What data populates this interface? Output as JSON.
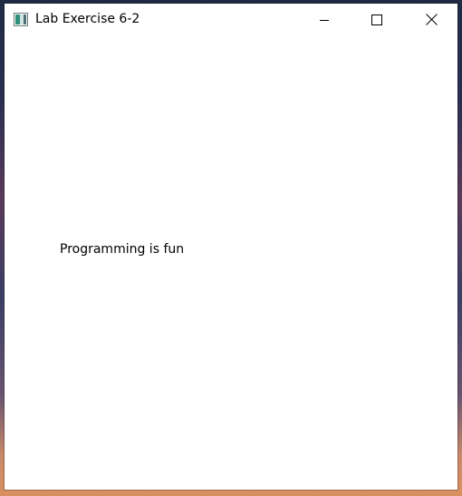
{
  "window": {
    "title": "Lab Exercise 6-2",
    "icon": "window-app-icon",
    "controls": {
      "minimize_icon": "minimize-icon",
      "maximize_icon": "maximize-icon",
      "close_icon": "close-icon"
    }
  },
  "content": {
    "label_text": "Programming is fun"
  }
}
